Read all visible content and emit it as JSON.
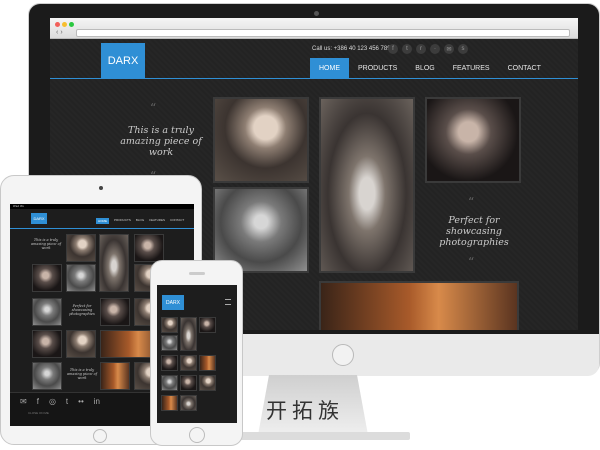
{
  "desktop": {
    "logo": "DARX",
    "phone": "Call us: +386 40 123 456 789",
    "menu": [
      "HOME",
      "PRODUCTS",
      "BLOG",
      "FEATURES",
      "CONTACT"
    ],
    "tagline_left": "This is a truly amazing piece of work",
    "tagline_right": "Perfect for showcasing photographies",
    "quote_glyph": "“"
  },
  "tablet": {
    "status": "iPad 3G",
    "logo": "DARX",
    "menu": [
      "HOME",
      "PRODUCTS",
      "BLOG",
      "FEATURES",
      "CONTACT"
    ],
    "tagline_1": "This is a truly amazing piece of work",
    "tagline_2": "Perfect for showcasing photographies",
    "tagline_3": "This is a truly amazing piece of work",
    "footer_labels": [
      "CLOSE ON ME",
      "FOLLOW US"
    ]
  },
  "phone": {
    "logo": "DARX"
  },
  "watermark": "开拓族",
  "colors": {
    "accent": "#2f8fd5"
  }
}
